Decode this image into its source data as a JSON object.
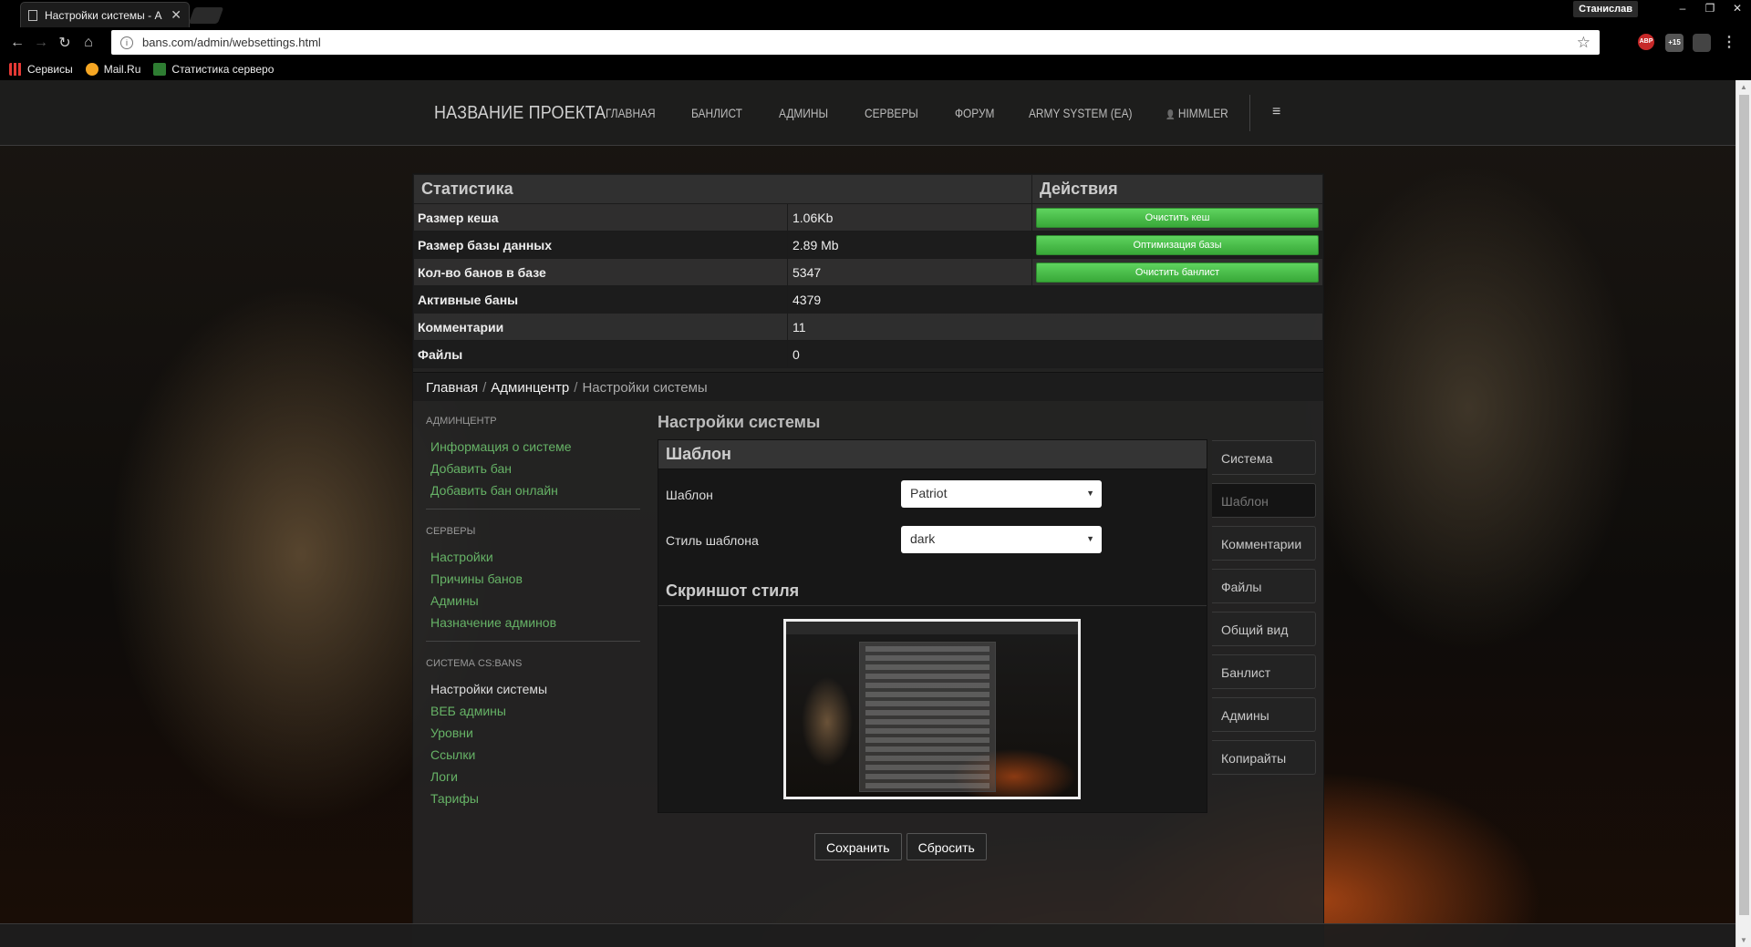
{
  "browser": {
    "tab_title": "Настройки системы - А",
    "tab_close": "✕",
    "profile_name": "Станислав",
    "window_buttons": [
      "–",
      "❐",
      "✕"
    ],
    "url": "bans.com/admin/websettings.html",
    "info_glyph": "i",
    "star_glyph": "☆",
    "ext_abp": "ABP",
    "ext_badge": "+15",
    "menu_glyph": "⋮",
    "nav": {
      "back": "←",
      "forward": "→",
      "reload": "↻",
      "home": "⌂"
    },
    "bookmarks": [
      "Сервисы",
      "Mail.Ru",
      "Статистика серверо"
    ]
  },
  "site": {
    "brand": "НАЗВАНИЕ ПРОЕКТА",
    "menu": [
      "ГЛАВНАЯ",
      "БАНЛИСТ",
      "АДМИНЫ",
      "СЕРВЕРЫ",
      "ФОРУМ",
      "ARMY SYSTEM (EA)"
    ],
    "user": "HIMMLER",
    "user_glyph": "👤",
    "burger_glyph": "≡"
  },
  "stats": {
    "header_left": "Статистика",
    "header_right": "Действия",
    "rows": [
      {
        "label": "Размер кеша",
        "value": "1.06Kb",
        "action": "Очистить кеш"
      },
      {
        "label": "Размер базы данных",
        "value": "2.89 Mb",
        "action": "Оптимизация базы"
      },
      {
        "label": "Кол-во банов в базе",
        "value": "5347",
        "action": "Очистить банлист"
      },
      {
        "label": "Активные баны",
        "value": "4379"
      },
      {
        "label": "Комментарии",
        "value": "11"
      },
      {
        "label": "Файлы",
        "value": "0"
      }
    ]
  },
  "breadcrumb": {
    "home": "Главная",
    "admin": "Админцентр",
    "sep": "/",
    "current": "Настройки системы"
  },
  "sidebar": {
    "groups": [
      {
        "title": "АДМИНЦЕНТР",
        "items": [
          "Информация о системе",
          "Добавить бан",
          "Добавить бан онлайн"
        ]
      },
      {
        "title": "СЕРВЕРЫ",
        "items": [
          "Настройки",
          "Причины банов",
          "Админы",
          "Назначение админов"
        ]
      },
      {
        "title": "СИСТЕМА CS:BANS",
        "items": [
          "Настройки системы",
          "ВЕБ админы",
          "Уровни",
          "Ссылки",
          "Логи",
          "Тарифы"
        ]
      }
    ]
  },
  "main": {
    "title": "Настройки системы",
    "panel_title": "Шаблон",
    "template_label": "Шаблон",
    "template_value": "Patriot",
    "style_label": "Стиль шаблона",
    "style_value": "dark",
    "screenshot_title": "Скриншот стиля",
    "save": "Сохранить",
    "reset": "Сбросить",
    "select_arrow": "▼"
  },
  "tabs": [
    "Система",
    "Шаблон",
    "Комментарии",
    "Файлы",
    "Общий вид",
    "Банлист",
    "Админы",
    "Копирайты"
  ],
  "active_tab": 1,
  "colors": {
    "link_green": "#66b266",
    "button_green": "#4cbb4c",
    "tab_active": "#141414"
  }
}
